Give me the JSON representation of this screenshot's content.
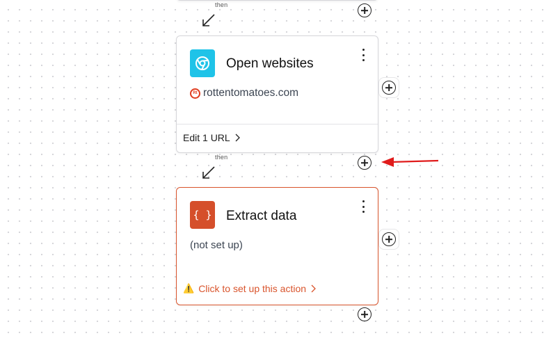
{
  "connectors": {
    "then_label_1": "then",
    "then_label_2": "then"
  },
  "open_websites": {
    "title": "Open websites",
    "site": "rottentomatoes.com",
    "site_logo_text": "Rt",
    "footer_label": "Edit 1 URL",
    "icon": "chrome-browser-icon",
    "icon_color": "#1fc3e8"
  },
  "extract_data": {
    "title": "Extract data",
    "status": "(not set up)",
    "footer_label": "Click to set up this action",
    "warning_glyph": "⚠️",
    "icon_glyph": "{ }",
    "icon_color": "#d54f2b",
    "border_color": "#d9542c"
  },
  "annotation": {
    "arrow_color": "#e01b1b"
  }
}
